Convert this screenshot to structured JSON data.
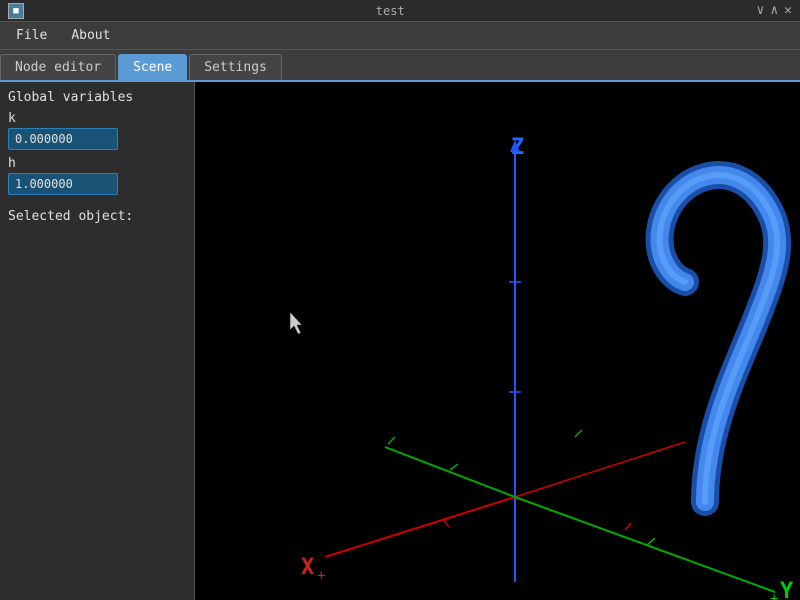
{
  "titlebar": {
    "title": "test",
    "icon": "■",
    "controls": [
      "∨",
      "∧",
      "✕"
    ]
  },
  "menubar": {
    "items": [
      "File",
      "About"
    ]
  },
  "tabs": [
    {
      "label": "Node editor",
      "active": false
    },
    {
      "label": "Scene",
      "active": true
    },
    {
      "label": "Settings",
      "active": false
    }
  ],
  "left_panel": {
    "section_title": "Global variables",
    "variables": [
      {
        "name": "k",
        "value": "0.000000"
      },
      {
        "name": "h",
        "value": "1.000000"
      }
    ],
    "selected_label": "Selected object:"
  },
  "viewport": {
    "axes": {
      "x_label": "X",
      "y_label": "Y",
      "z_label": "Z"
    }
  }
}
